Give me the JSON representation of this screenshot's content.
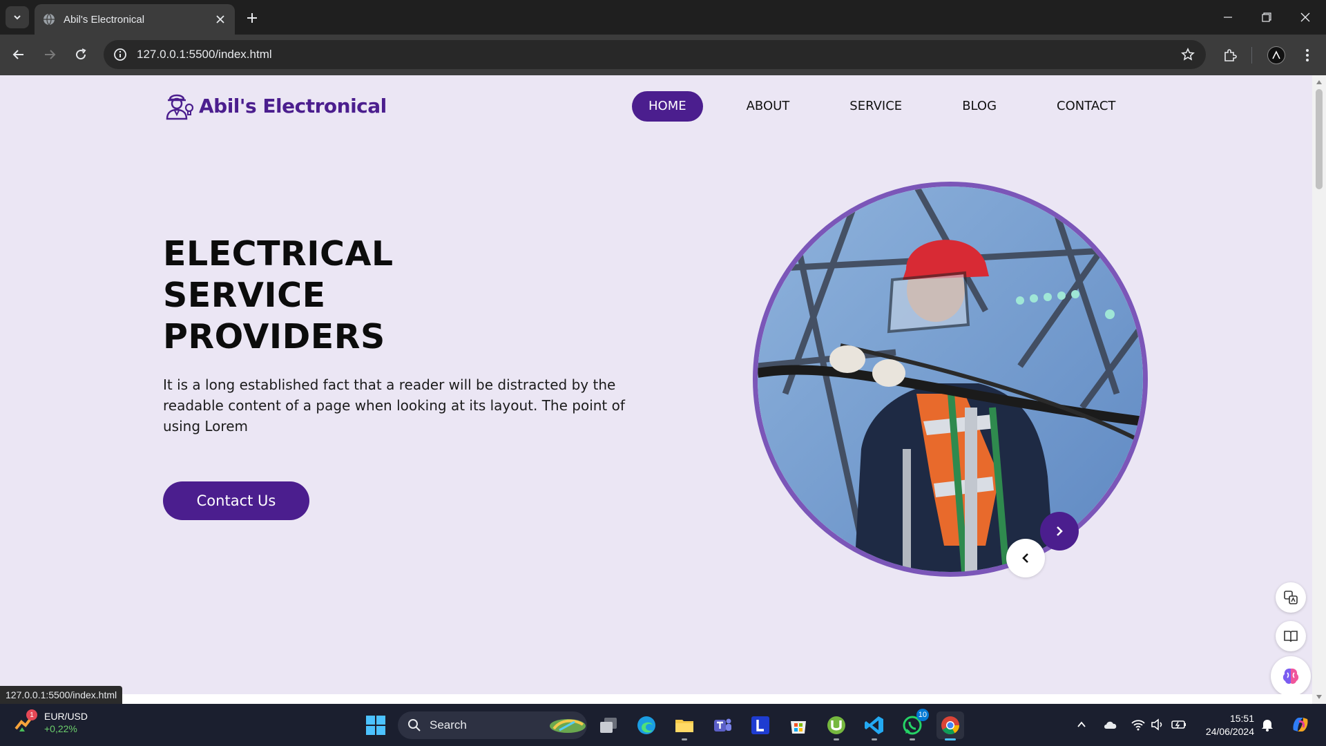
{
  "browser": {
    "tab_title": "Abil's Electronical",
    "url": "127.0.0.1:5500/index.html",
    "status_url": "127.0.0.1:5500/index.html"
  },
  "site": {
    "brand": "Abil's Electronical",
    "nav": [
      {
        "label": "HOME",
        "active": true
      },
      {
        "label": "ABOUT",
        "active": false
      },
      {
        "label": "SERVICE",
        "active": false
      },
      {
        "label": "BLOG",
        "active": false
      },
      {
        "label": "CONTACT",
        "active": false
      }
    ],
    "hero": {
      "title_lines": [
        "ELECTRICAL",
        "SERVICE",
        "PROVIDERS"
      ],
      "body": "It is a long established fact that a reader will be distracted by the readable content of a page when looking at its layout. The point of using Lorem",
      "cta": "Contact Us"
    }
  },
  "taskbar": {
    "ticker": {
      "symbol": "EUR/USD",
      "change": "+0,22%",
      "badge": "1"
    },
    "search_label": "Search",
    "whatsapp_badge": "10",
    "clock": {
      "time": "15:51",
      "date": "24/06/2024"
    }
  },
  "colors": {
    "brand": "#4b1e8e",
    "page_bg": "#ebe6f4",
    "image_ring": "#7b56b8"
  }
}
